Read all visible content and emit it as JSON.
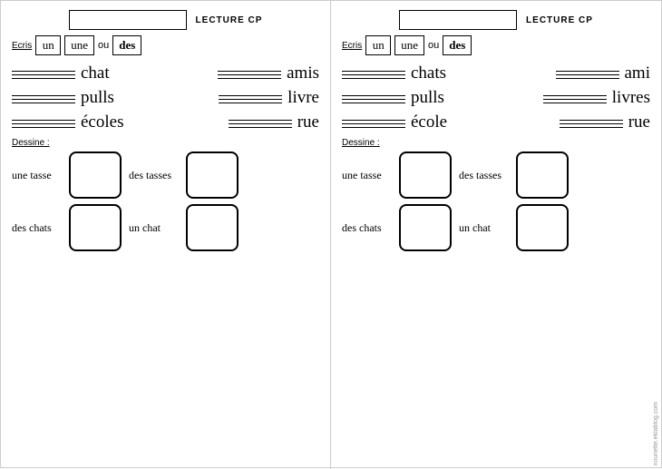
{
  "left": {
    "title": "LECTURE CP",
    "ecris": {
      "label": "Ecris",
      "words": [
        "un",
        "une",
        "ou",
        "des"
      ]
    },
    "word_rows": [
      {
        "word": "chat",
        "word2": "amis"
      },
      {
        "word": "pulls",
        "word2": "livre"
      },
      {
        "word": "écoles",
        "word2": "rue"
      }
    ],
    "dessine": {
      "label": "Dessine :",
      "rows": [
        {
          "text1": "une tasse",
          "text2": "des tasses"
        },
        {
          "text1": "des chats",
          "text2": "un chat"
        }
      ]
    }
  },
  "right": {
    "title": "LECTURE CP",
    "ecris": {
      "label": "Ecris",
      "words": [
        "un",
        "une",
        "ou",
        "des"
      ]
    },
    "word_rows": [
      {
        "word": "chats",
        "word2": "ami"
      },
      {
        "word": "pulls",
        "word2": "livres"
      },
      {
        "word": "école",
        "word2": "rue"
      }
    ],
    "dessine": {
      "label": "Dessine :",
      "rows": [
        {
          "text1": "une tasse",
          "text2": "des tasses"
        },
        {
          "text1": "des chats",
          "text2": "un chat"
        }
      ]
    }
  },
  "watermark": "nounette.eklablog.com"
}
